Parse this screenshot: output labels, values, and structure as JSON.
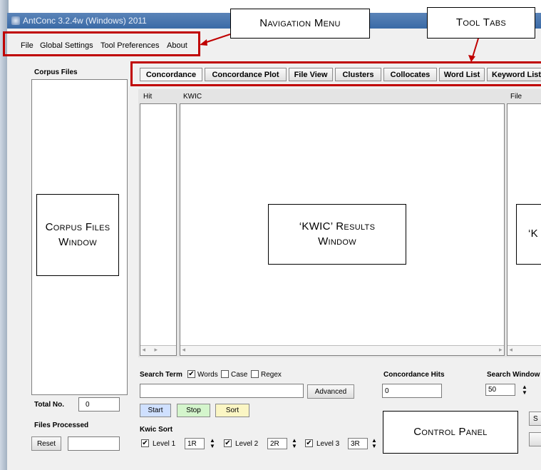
{
  "window": {
    "title": "AntConc 3.2.4w (Windows) 2011"
  },
  "menu": {
    "items": [
      "File",
      "Global Settings",
      "Tool Preferences",
      "About"
    ]
  },
  "tabs": [
    "Concordance",
    "Concordance Plot",
    "File View",
    "Clusters",
    "Collocates",
    "Word List",
    "Keyword List"
  ],
  "corpus": {
    "label": "Corpus Files",
    "total_label": "Total No.",
    "total_value": "0",
    "processed_label": "Files Processed",
    "reset_label": "Reset"
  },
  "results": {
    "hit_header": "Hit",
    "kwic_header": "KWIC",
    "file_header": "File"
  },
  "search": {
    "term_label": "Search Term",
    "words_label": "Words",
    "case_label": "Case",
    "regex_label": "Regex",
    "words_checked": true,
    "case_checked": false,
    "regex_checked": false,
    "input_value": "",
    "advanced_label": "Advanced",
    "start_label": "Start",
    "stop_label": "Stop",
    "sort_label": "Sort",
    "hits_label": "Concordance Hits",
    "hits_value": "0",
    "window_label": "Search Window Size",
    "window_value": "50"
  },
  "kwic_sort": {
    "label": "Kwic Sort",
    "levels": [
      {
        "label": "Level 1",
        "value": "1R",
        "checked": true
      },
      {
        "label": "Level 2",
        "value": "2R",
        "checked": true
      },
      {
        "label": "Level 3",
        "value": "3R",
        "checked": true
      }
    ]
  },
  "callouts": {
    "nav_menu": "Navigation Menu",
    "tool_tabs": "Tool Tabs",
    "corpus_window": "Corpus Files Window",
    "kwic_window": "‘KWIC’ Results Window",
    "file_window": "‘K",
    "control_panel": "Control Panel"
  },
  "colors": {
    "annotation_border": "#c00000",
    "start_btn": "#cfe0ff",
    "stop_btn": "#d4f5cc",
    "sort_btn": "#fbf6c4"
  }
}
